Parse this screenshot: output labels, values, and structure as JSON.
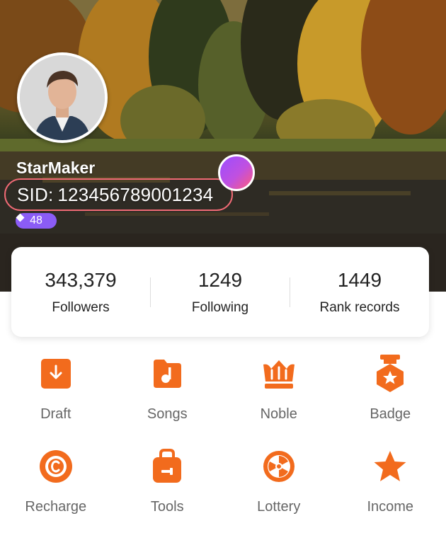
{
  "profile": {
    "username": "StarMaker",
    "sid_label": "SID:",
    "sid_value": "123456789001234",
    "level": "48"
  },
  "stats": [
    {
      "value": "343,379",
      "label": "Followers"
    },
    {
      "value": "1249",
      "label": "Following"
    },
    {
      "value": "1449",
      "label": "Rank records"
    }
  ],
  "menu": [
    {
      "label": "Draft",
      "icon": "draft-icon"
    },
    {
      "label": "Songs",
      "icon": "songs-icon"
    },
    {
      "label": "Noble",
      "icon": "crown-icon"
    },
    {
      "label": "Badge",
      "icon": "badge-icon"
    },
    {
      "label": "Recharge",
      "icon": "recharge-icon"
    },
    {
      "label": "Tools",
      "icon": "toolbox-icon"
    },
    {
      "label": "Lottery",
      "icon": "lottery-wheel-icon"
    },
    {
      "label": "Income",
      "icon": "star-icon"
    }
  ],
  "colors": {
    "accent": "#f26b1d",
    "sid_border": "#f06a75",
    "level_badge": "#8b5cf6"
  }
}
